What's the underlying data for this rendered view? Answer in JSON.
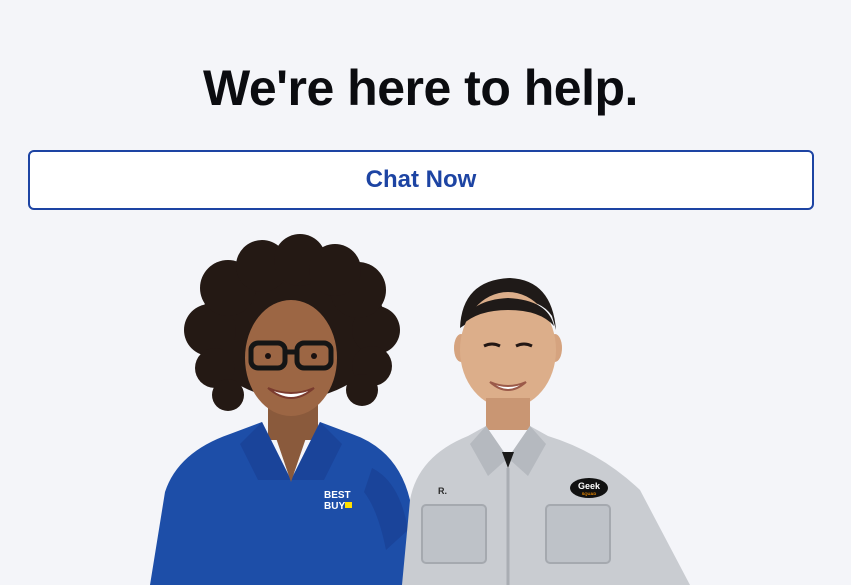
{
  "headline": "We're here to help.",
  "chat_button": {
    "label": "Chat Now"
  },
  "hero": {
    "logo_text": "BEST BUY",
    "name_tag": "R.",
    "badge_text": "Geek",
    "badge_subtext": "SQUAD"
  },
  "colors": {
    "background": "#f4f5f9",
    "headline": "#0b0c10",
    "accent": "#1d44a3",
    "polo_blue": "#1d4ea8",
    "shirt_gray": "#c9ccd1"
  },
  "icons": [
    "best-buy-logo-icon",
    "geek-squad-badge-icon"
  ]
}
